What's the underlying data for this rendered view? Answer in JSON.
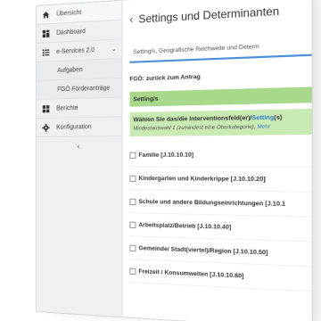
{
  "sidebar": {
    "items": [
      {
        "label": "Übersicht",
        "icon": "home-icon"
      },
      {
        "label": "Dashboard",
        "icon": "dashboard-icon"
      },
      {
        "label": "e-Services 2.0",
        "icon": "list-icon"
      },
      {
        "label": "Aufgaben"
      },
      {
        "label": "FGÖ Förderanträge"
      },
      {
        "label": "Berichte",
        "icon": "grid-icon"
      },
      {
        "label": "Konfiguration",
        "icon": "gear-icon"
      }
    ],
    "collapse_glyph": "‹",
    "expand_glyph": "⌄"
  },
  "main": {
    "back_glyph": "‹",
    "title": "Settings und Determinanten",
    "tab_label": "Setting/s, Geografische Reichweite und Determ",
    "back_link": "FGÖ: zurück zum Antrag",
    "section_title": "Setting/s",
    "choose": {
      "prefix": "Wählen Sie das/die Interventionsfeld(er)/",
      "link": "Setting",
      "suffix": "(s)",
      "line2_prefix": "Mindestauswahl 1 (zumindest eine Oberkategorie), ",
      "line2_hint": "Mehr"
    },
    "checklist": [
      "Familie [J.10.10.10]",
      "Kindergarten und Kinderkrippe [J.10.10.20]",
      "Schule und andere Bildungseinrichtungen [J.10.1",
      "Arbeitsplatz/Betrieb [J.10.10.40]",
      "Gemeinde/ Stadt(viertel)/Region [J.10.10.50]",
      "Freizeit / Konsumwelten [J.10.10.60]"
    ]
  },
  "colors": {
    "accent": "#4a90d9",
    "section_green": "#a8d98a",
    "choose_green": "#c9eab2",
    "link_blue": "#2f7fd1",
    "sidebar_bg": "#eef0f2"
  }
}
